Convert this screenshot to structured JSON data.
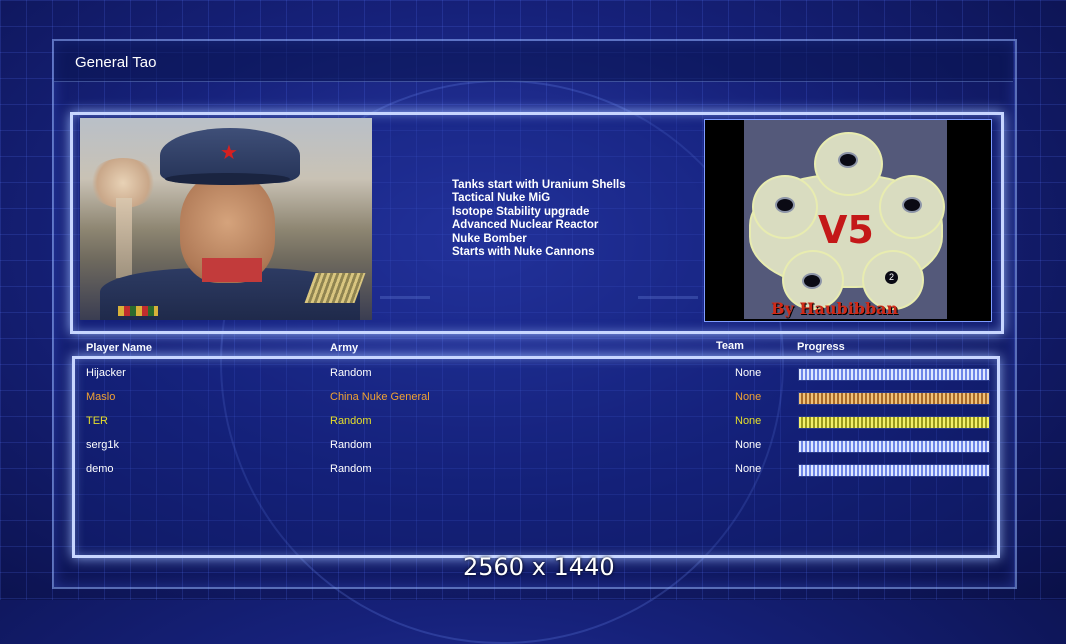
{
  "window": {
    "title": "General Tao"
  },
  "general_info": {
    "lines": [
      "Tanks start with Uranium Shells",
      "Tactical Nuke MiG",
      "Isotope Stability upgrade",
      "Advanced Nuclear Reactor",
      "Nuke Bomber",
      "Starts with Nuke Cannons"
    ]
  },
  "map_preview": {
    "title_text": "V5",
    "byline": "By Haubibban",
    "badge": "2"
  },
  "table": {
    "headers": {
      "player_name": "Player Name",
      "army": "Army",
      "team": "Team",
      "progress": "Progress"
    },
    "rows": [
      {
        "name": "Hijacker",
        "army": "Random",
        "team": "None",
        "color": "#ffffff",
        "progress": 1.0,
        "bar_style": "blue"
      },
      {
        "name": "Maslo",
        "army": "China Nuke General",
        "team": "None",
        "color": "#f0a232",
        "progress": 1.0,
        "bar_style": "orange"
      },
      {
        "name": "TER",
        "army": "Random",
        "team": "None",
        "color": "#e6df2a",
        "progress": 1.0,
        "bar_style": "yellow"
      },
      {
        "name": "serg1k",
        "army": "Random",
        "team": "None",
        "color": "#ffffff",
        "progress": 1.0,
        "bar_style": "blue"
      },
      {
        "name": "demo",
        "army": "Random",
        "team": "None",
        "color": "#ffffff",
        "progress": 1.0,
        "bar_style": "blue"
      }
    ]
  },
  "overlay": {
    "resolution": "2560 x 1440"
  },
  "colors": {
    "accent_border": "#c8d6ff",
    "background": "#16217a"
  },
  "icons": {
    "portrait_cap_star": "star-icon"
  }
}
